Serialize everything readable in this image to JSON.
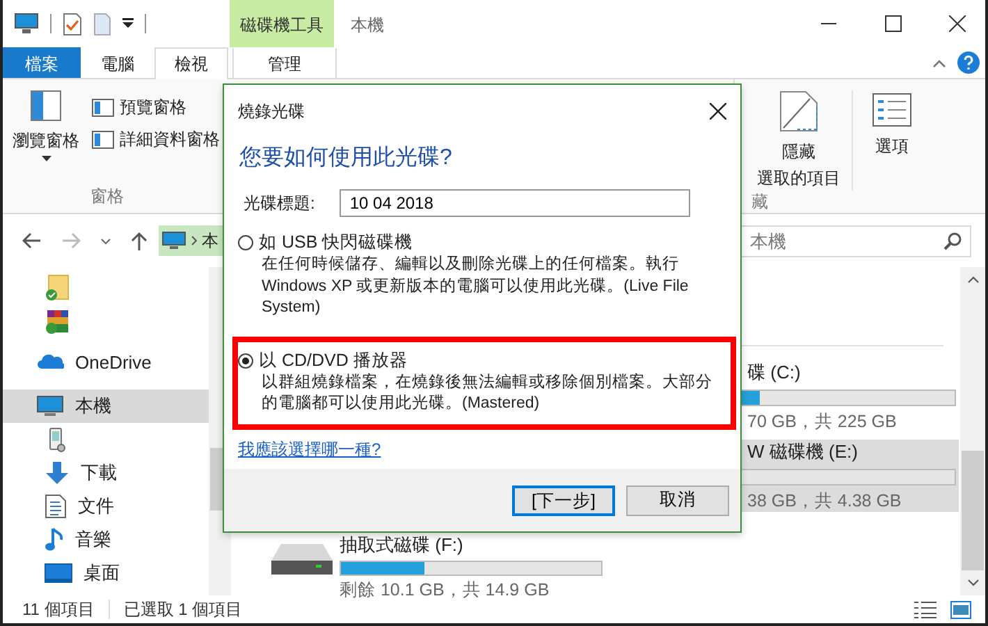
{
  "window": {
    "title": "本機",
    "context_tab": "磁碟機工具"
  },
  "ribbon_tabs": [
    {
      "label": "檔案",
      "kind": "file",
      "selected": false
    },
    {
      "label": "電腦",
      "kind": "tab",
      "selected": false
    },
    {
      "label": "檢視",
      "kind": "tab",
      "selected": true
    },
    {
      "label": "管理",
      "kind": "context",
      "selected": false
    }
  ],
  "ribbon": {
    "large_button": "瀏覽窗格",
    "small_buttons": [
      "預覽窗格",
      "詳細資料窗格"
    ],
    "group_label": "窗格",
    "right_group_label": "藏",
    "right_buttons": [
      {
        "kind": "hide",
        "lines": [
          "隱藏",
          "選取的項目"
        ]
      },
      {
        "kind": "options",
        "lines": [
          "選項"
        ]
      }
    ]
  },
  "address": {
    "breadcrumb": "本",
    "search_placeholder": "本機"
  },
  "sidebar": {
    "items": [
      {
        "kind": "folder",
        "selected": false
      },
      {
        "kind": "archive",
        "selected": false
      },
      {
        "kind": "cloud",
        "label": "OneDrive",
        "selected": false
      },
      {
        "kind": "pc",
        "label": "本機",
        "selected": true
      },
      {
        "kind": "phone",
        "selected": false
      },
      {
        "kind": "download",
        "label": "下載",
        "selected": false
      },
      {
        "kind": "document",
        "label": "文件",
        "selected": false
      },
      {
        "kind": "music",
        "label": "音樂",
        "selected": false
      },
      {
        "kind": "desktop",
        "label": "桌面",
        "selected": false
      }
    ]
  },
  "drives": [
    {
      "kind": "covered",
      "name": "碟 (C:)",
      "level": 0.25,
      "space": "70 GB，共 225 GB",
      "selected": false
    },
    {
      "kind": "covered",
      "name": "W 磁碟機 (E:)",
      "space": "38 GB，共 4.38 GB",
      "selected": true
    },
    {
      "kind": "tile",
      "name": "抽取式磁碟 (F:)",
      "level": 0.32,
      "space": "剩餘 10.1 GB，共 14.9 GB",
      "selected": false
    }
  ],
  "status_bar": {
    "count": "11 個項目",
    "selection": "已選取 1 個項目"
  },
  "dialog": {
    "title": "燒錄光碟",
    "heading": "您要如何使用此光碟?",
    "disc_label": "光碟標題:",
    "disc_title": "10 04 2018",
    "options": [
      {
        "title": "如 USB 快閃磁碟機",
        "description": "在任何時候儲存、編輯以及刪除光碟上的任何檔案。執行 Windows XP 或更新版本的電腦可以使用此光碟。(Live File System)",
        "selected": false,
        "highlighted": false
      },
      {
        "title": "以 CD/DVD 播放器",
        "description": "以群組燒錄檔案，在燒錄後無法編輯或移除個別檔案。大部分的電腦都可以使用此光碟。(Mastered)",
        "selected": true,
        "highlighted": true
      }
    ],
    "help_link": "我應該選擇哪一種?",
    "buttons": [
      {
        "label": "[下一步]",
        "kind": "default"
      },
      {
        "label": "取消",
        "kind": "normal"
      }
    ]
  }
}
